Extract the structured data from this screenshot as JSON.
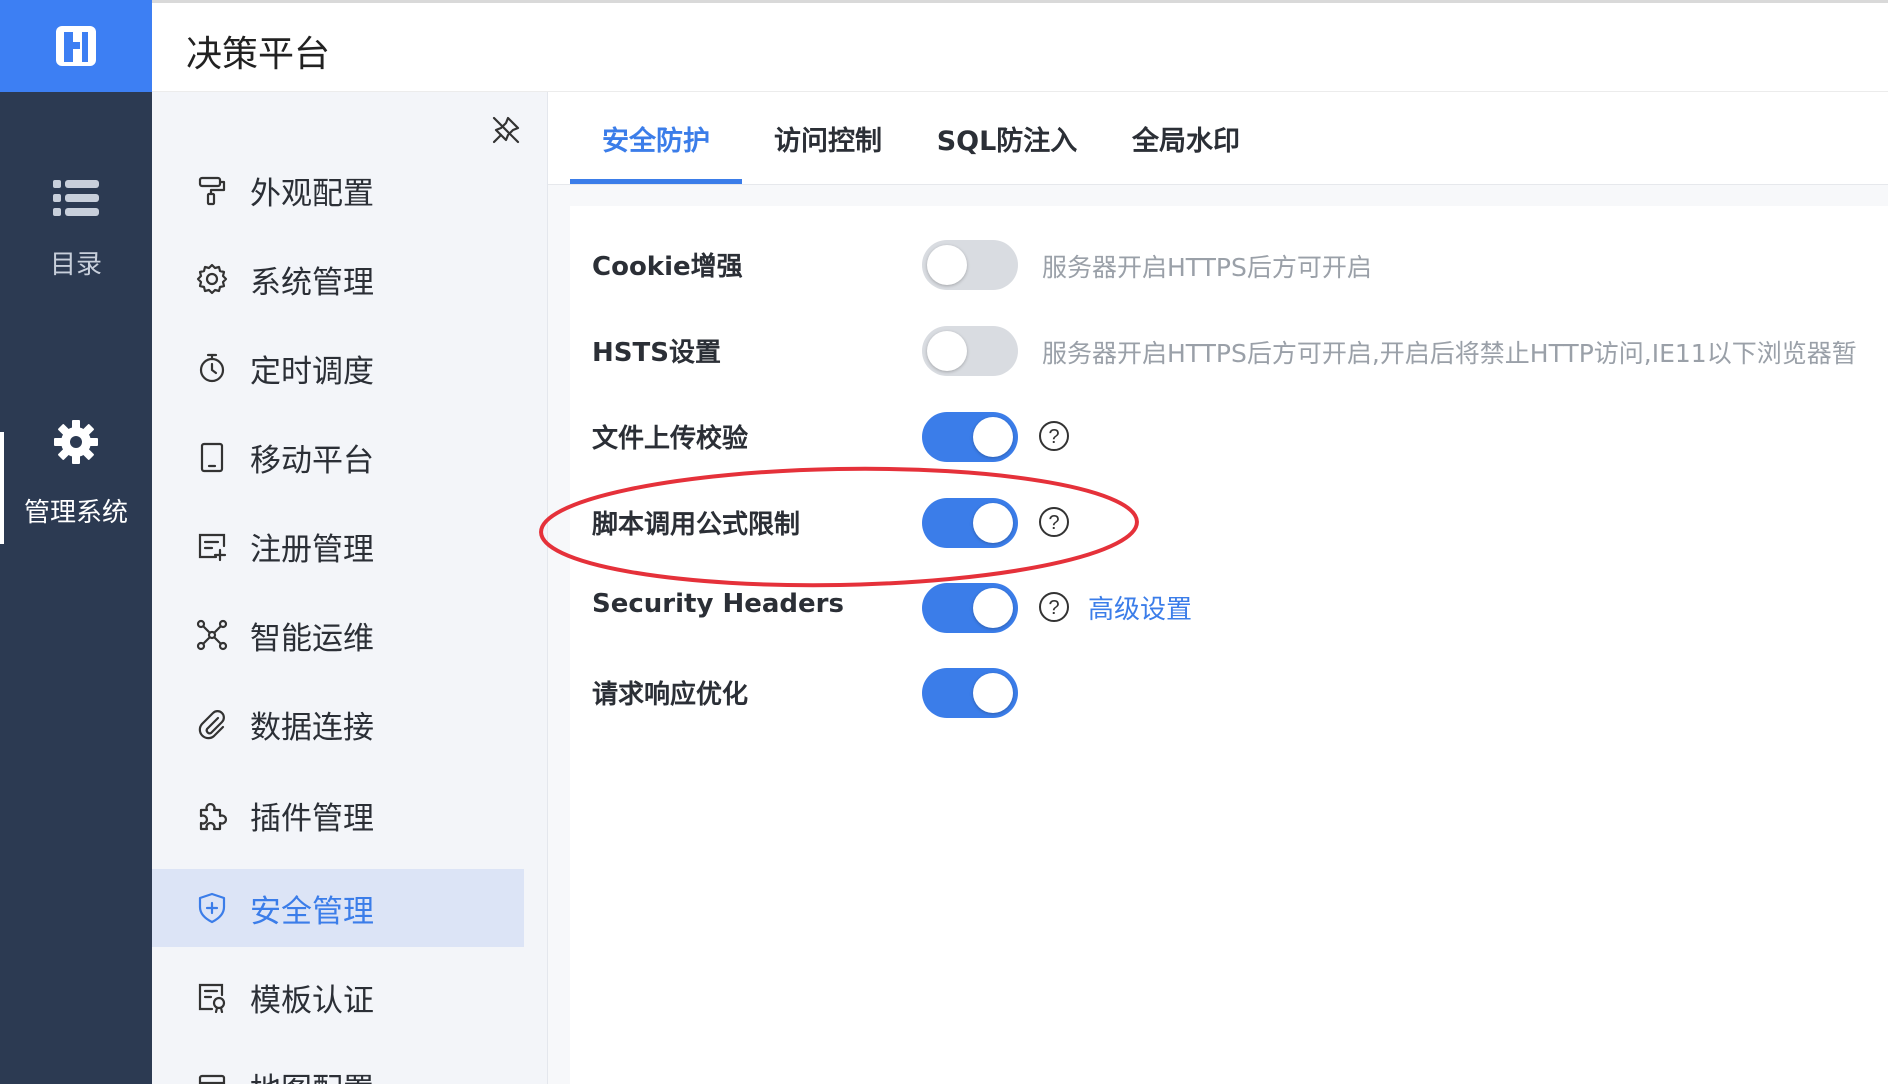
{
  "header": {
    "title": "决策平台"
  },
  "rail": {
    "items": [
      {
        "label": "目录",
        "icon": "list-icon"
      },
      {
        "label": "管理系统",
        "icon": "gear-icon"
      }
    ]
  },
  "menu": {
    "items": [
      {
        "label": "外观配置",
        "icon": "paint-roller-icon"
      },
      {
        "label": "系统管理",
        "icon": "gear-outline-icon"
      },
      {
        "label": "定时调度",
        "icon": "timer-icon"
      },
      {
        "label": "移动平台",
        "icon": "tablet-icon"
      },
      {
        "label": "注册管理",
        "icon": "register-icon"
      },
      {
        "label": "智能运维",
        "icon": "network-icon"
      },
      {
        "label": "数据连接",
        "icon": "paperclip-icon"
      },
      {
        "label": "插件管理",
        "icon": "puzzle-icon"
      },
      {
        "label": "安全管理",
        "icon": "shield-icon",
        "active": true
      },
      {
        "label": "模板认证",
        "icon": "certificate-icon"
      },
      {
        "label": "地图配置",
        "icon": "map-icon"
      }
    ]
  },
  "tabs": [
    {
      "label": "安全防护",
      "active": true
    },
    {
      "label": "访问控制"
    },
    {
      "label": "SQL防注入"
    },
    {
      "label": "全局水印"
    }
  ],
  "settings": [
    {
      "label": "Cookie增强",
      "enabled": false,
      "hint": "服务器开启HTTPS后方可开启"
    },
    {
      "label": "HSTS设置",
      "enabled": false,
      "hint": "服务器开启HTTPS后方可开启,开启后将禁止HTTP访问,IE11以下浏览器暂"
    },
    {
      "label": "文件上传校验",
      "enabled": true
    },
    {
      "label": "脚本调用公式限制",
      "enabled": true
    },
    {
      "label": "Security Headers",
      "enabled": true,
      "link": "高级设置"
    },
    {
      "label": "请求响应优化",
      "enabled": true
    }
  ],
  "colors": {
    "accent": "#3b7de9",
    "rail": "#2c3a52",
    "logo": "#3d7ff3",
    "annotation": "#e5313a"
  }
}
